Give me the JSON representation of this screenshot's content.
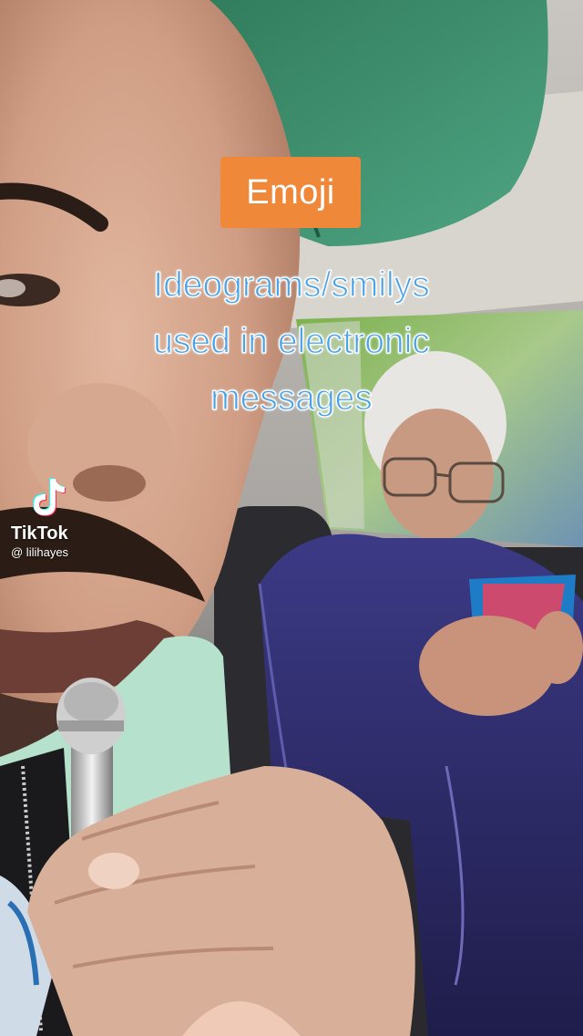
{
  "overlay": {
    "tag_label": "Emoji",
    "caption_lines": [
      "Ideograms/smilys",
      "used in electronic",
      "messages"
    ]
  },
  "watermark": {
    "brand": "TikTok",
    "handle": "@ lilihayes",
    "icon": "tiktok-logo-icon"
  },
  "colors": {
    "tag_background": "#f0883a",
    "caption_text": "#4aa3e6",
    "caption_outline": "#ffffff"
  }
}
